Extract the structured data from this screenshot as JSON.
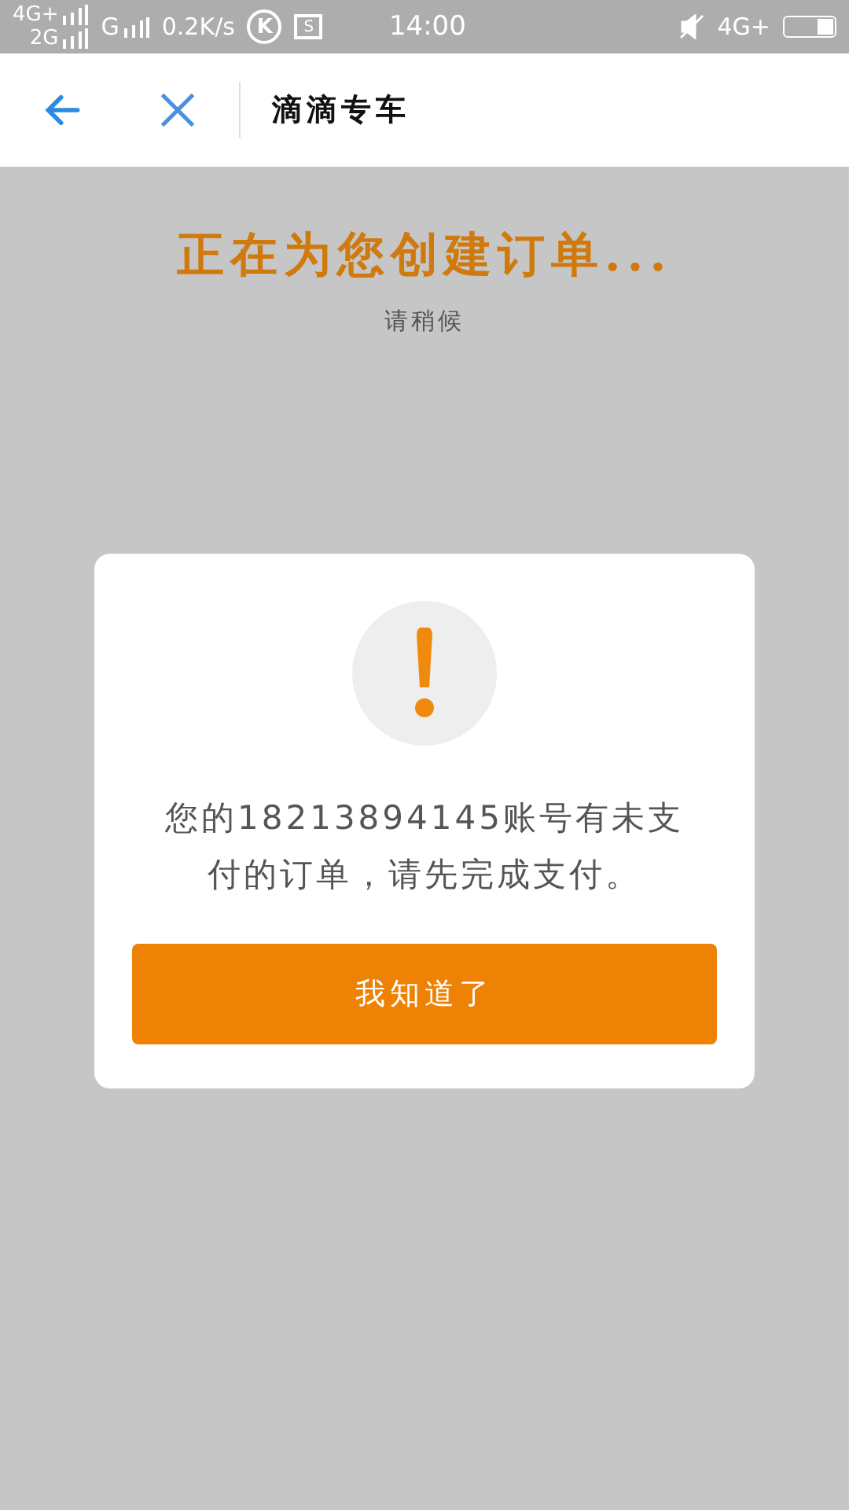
{
  "status_bar": {
    "sim_1": "4G+",
    "sim_2": "2G",
    "network": "G",
    "speed": "0.2K/s",
    "app_badge": "K",
    "screenshot_badge": "S",
    "time": "14:00",
    "right_network": "4G+",
    "muted": true
  },
  "nav_bar": {
    "title": "滴滴专车"
  },
  "loading": {
    "title": "正在为您创建订单...",
    "subtitle": "请稍候"
  },
  "dialog": {
    "message": "您的18213894145账号有未支付的订单，请先完成支付。",
    "button": "我知道了"
  }
}
